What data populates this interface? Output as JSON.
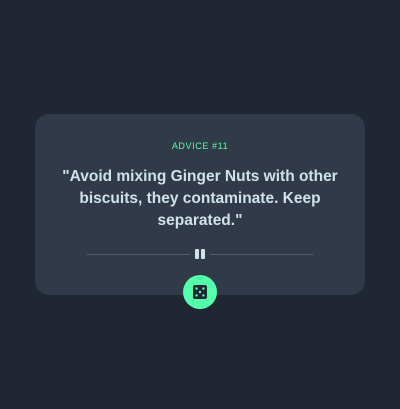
{
  "advice": {
    "label": "ADVICE #11",
    "quote": "\"Avoid mixing Ginger Nuts with other biscuits, they contaminate. Keep separated.\""
  },
  "divider": {
    "icon": "pause-icon"
  },
  "dice_button": {
    "icon": "dice-icon"
  },
  "colors": {
    "background": "#202733",
    "card": "#313a48",
    "accent": "#53ffaa",
    "text": "#cee3e9",
    "divider": "#4f5d74"
  }
}
